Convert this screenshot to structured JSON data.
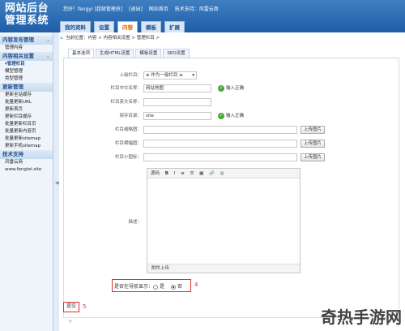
{
  "app": {
    "title_line1": "网站后台",
    "title_line2": "管理系统",
    "user_info": [
      "您好！fengyi [超级管理员]",
      "[退出]",
      "网站首页",
      "技术支持：风雷云商"
    ]
  },
  "topnav": [
    "我的资料",
    "设置",
    "内容",
    "模板",
    "扩展"
  ],
  "sidebar": {
    "sections": [
      {
        "title": "内容发布管理",
        "items": [
          "管理内容"
        ]
      },
      {
        "title": "内容相关设置",
        "items": [
          "管理栏目",
          "模型管理",
          "类型管理"
        ]
      },
      {
        "title": "更新管理",
        "items": [
          "更新全站缓存",
          "批量更新URL",
          "更新首页",
          "更新栏目缓存",
          "批量更新栏目页",
          "批量更新内容页",
          "批量更新sitemap",
          "更新手机sitemap"
        ]
      },
      {
        "title": "技术支持",
        "items": [
          "风雷云商",
          "www.fenglei.site"
        ]
      }
    ]
  },
  "breadcrumb": "当前位置：内容 > 内容相关设置 > 管理栏目 >",
  "tabs": [
    "基本选项",
    "生成HTML设置",
    "模板设置",
    "SEO设置"
  ],
  "form": {
    "parent_label": "上级栏目：",
    "parent_value": "≡ 作为一级栏目 ≡",
    "cn_name_label": "栏目中文名称：",
    "cn_name_value": "网站地图",
    "en_name_label": "栏目英文名称：",
    "dir_label": "保存目录：",
    "dir_value": "site",
    "thumb_label": "栏目缩略图：",
    "banner_label": "栏目横幅图：",
    "icon_label": "栏目小图标：",
    "desc_label": "描述：",
    "nav_label": "是否在导航显示：",
    "nav_yes": "是",
    "nav_no": "否",
    "ok_text": "输入正确",
    "upload_label": "上传图片",
    "submit_label": "提交"
  },
  "editor": {
    "toolbar": [
      "源码",
      "B",
      "I",
      "≡",
      "☰",
      "▦",
      "🔗",
      "◎"
    ],
    "attach_label": "附件上传"
  },
  "annotations": {
    "nav": "4",
    "submit": "5"
  },
  "watermark": "奇热手游网"
}
